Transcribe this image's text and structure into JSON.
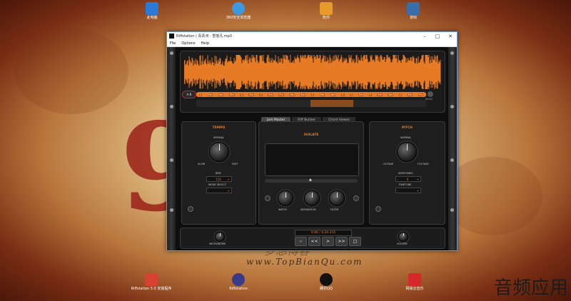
{
  "desktop": {
    "icons": [
      {
        "label": "此电脑",
        "color": "#2a7ad6"
      },
      {
        "label": "360安全浏览器",
        "color": "#3d98e0"
      },
      {
        "label": "软件",
        "color": "#e89a2a"
      },
      {
        "label": "游戏",
        "color": "#3a6ea8"
      },
      {
        "label": "Riffstation 5.0 安装程序",
        "color": "#d84030"
      },
      {
        "label": "Riffstation",
        "color": "#3a3a8a"
      },
      {
        "label": "腾讯QQ",
        "color": "#111111"
      },
      {
        "label": "网易云音乐",
        "color": "#d6282a"
      }
    ],
    "watermark_cn": "梦想博客",
    "watermark": "www.TopBianQu.com",
    "corner_text": "音频应用"
  },
  "window": {
    "title": "Riffstation | 青青河 · 雪落凡.mp3",
    "menu": [
      "File",
      "Options",
      "Help"
    ],
    "ab_label": "A·B",
    "chords": [
      "C",
      "Em",
      "Am",
      "Dm",
      "G",
      "Em",
      "C",
      "Em",
      "Fm",
      "Dm",
      "Em",
      "C",
      "Em",
      "Am",
      "G",
      "C",
      "Em",
      "F",
      "Em",
      "Dm",
      "C",
      "Em",
      "Fm"
    ],
    "scroll_label": "Scroll",
    "tabs": [
      "Jam Master",
      "Riff Builder",
      "Chord Viewer"
    ],
    "tempo": {
      "title": "TEMPO",
      "normal": "NORMAL",
      "slow": "SLOW",
      "fast": "FAST",
      "bpm_label": "BPM",
      "bpm_value": "110",
      "mode_label": "MODE SELECT"
    },
    "isolate": {
      "title": "ISOLATE",
      "width": "WIDTH",
      "separation": "SEPARATION",
      "filter": "FILTER"
    },
    "pitch": {
      "title": "PITCH",
      "normal": "NORMAL",
      "minus_octave": "-OCTAVE",
      "plus_octave": "+OCTAVE",
      "semitones_label": "SEMITONES",
      "semitones_value": "0",
      "finetune_label": "FINETUNE"
    },
    "transport": {
      "time": "0:00 / 4:20.415",
      "metronome": "METRONOME",
      "volume": "VOLUME",
      "buttons": [
        "∞",
        "<<",
        ">",
        ">>",
        "□"
      ]
    },
    "accent": "#e77a24"
  }
}
